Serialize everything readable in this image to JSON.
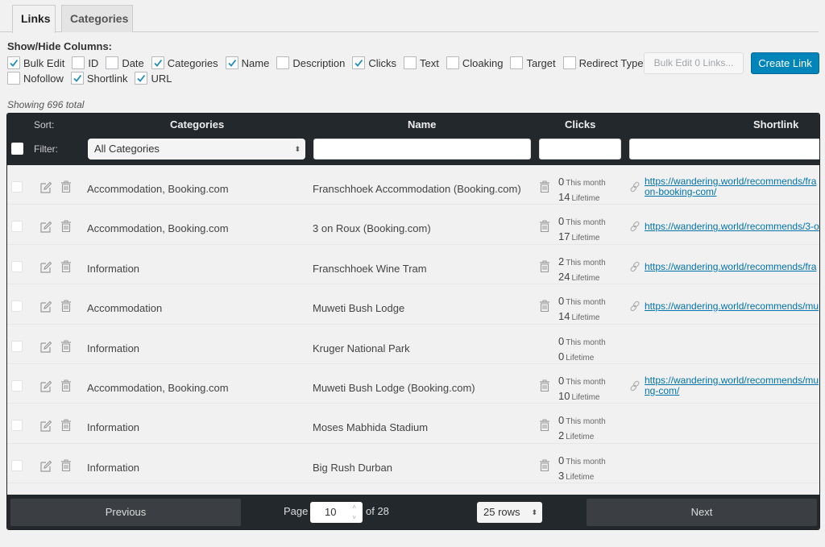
{
  "tabs": [
    {
      "label": "Links",
      "active": true
    },
    {
      "label": "Categories",
      "active": false
    }
  ],
  "show_hide": {
    "title": "Show/Hide Columns:",
    "row1": [
      {
        "label": "Bulk Edit",
        "checked": true
      },
      {
        "label": "ID",
        "checked": false
      },
      {
        "label": "Date",
        "checked": false
      },
      {
        "label": "Categories",
        "checked": true
      },
      {
        "label": "Name",
        "checked": true
      },
      {
        "label": "Description",
        "checked": false
      },
      {
        "label": "Clicks",
        "checked": true
      },
      {
        "label": "Text",
        "checked": false
      },
      {
        "label": "Cloaking",
        "checked": false
      },
      {
        "label": "Target",
        "checked": false
      },
      {
        "label": "Redirect Type",
        "checked": false
      }
    ],
    "row2": [
      {
        "label": "Nofollow",
        "checked": false
      },
      {
        "label": "Shortlink",
        "checked": true
      },
      {
        "label": "URL",
        "checked": true
      }
    ]
  },
  "toolbar": {
    "bulk_edit_label": "Bulk Edit 0 Links...",
    "create_link_label": "Create Link"
  },
  "showing_text": "Showing 696 total",
  "table": {
    "sort_label": "Sort:",
    "filter_label": "Filter:",
    "headers": {
      "categories": "Categories",
      "name": "Name",
      "clicks": "Clicks",
      "shortlink": "Shortlink"
    },
    "category_filter_value": "All Categories",
    "name_filter_value": "",
    "clicks_filter_value": "",
    "shortlink_filter_value": "",
    "this_month_label": "This month",
    "lifetime_label": "Lifetime",
    "rows": [
      {
        "category": "Accommodation, Booking.com",
        "name": "Franschhoek Accommodation (Booking.com)",
        "month": "0",
        "lifetime": "14",
        "shortlink": "https://wandering.world/recommends/fra",
        "shortlink2": "on-booking-com/"
      },
      {
        "category": "Accommodation, Booking.com",
        "name": "3 on Roux (Booking.com)",
        "month": "0",
        "lifetime": "17",
        "shortlink": "https://wandering.world/recommends/3-o",
        "shortlink2": ""
      },
      {
        "category": "Information",
        "name": "Franschhoek Wine Tram",
        "month": "2",
        "lifetime": "24",
        "shortlink": "https://wandering.world/recommends/fra",
        "shortlink2": ""
      },
      {
        "category": "Accommodation",
        "name": "Muweti Bush Lodge",
        "month": "0",
        "lifetime": "14",
        "shortlink": "https://wandering.world/recommends/mu",
        "shortlink2": ""
      },
      {
        "category": "Information",
        "name": "Kruger National Park",
        "month": "0",
        "lifetime": "0",
        "shortlink": "",
        "shortlink2": ""
      },
      {
        "category": "Accommodation, Booking.com",
        "name": "Muweti Bush Lodge (Booking.com)",
        "month": "0",
        "lifetime": "10",
        "shortlink": "https://wandering.world/recommends/mu",
        "shortlink2": "ng-com/"
      },
      {
        "category": "Information",
        "name": "Moses Mabhida Stadium",
        "month": "0",
        "lifetime": "2",
        "shortlink": "",
        "shortlink2": ""
      },
      {
        "category": "Information",
        "name": "Big Rush Durban",
        "month": "0",
        "lifetime": "3",
        "shortlink": "",
        "shortlink2": ""
      }
    ]
  },
  "pagination": {
    "previous_label": "Previous",
    "next_label": "Next",
    "page_label": "Page",
    "current_page": "10",
    "of_label": "of 28",
    "rows_per_page": "25 rows"
  },
  "colors": {
    "primary": "#0085ba",
    "header_bg": "#23282d",
    "link": "#0073aa"
  }
}
